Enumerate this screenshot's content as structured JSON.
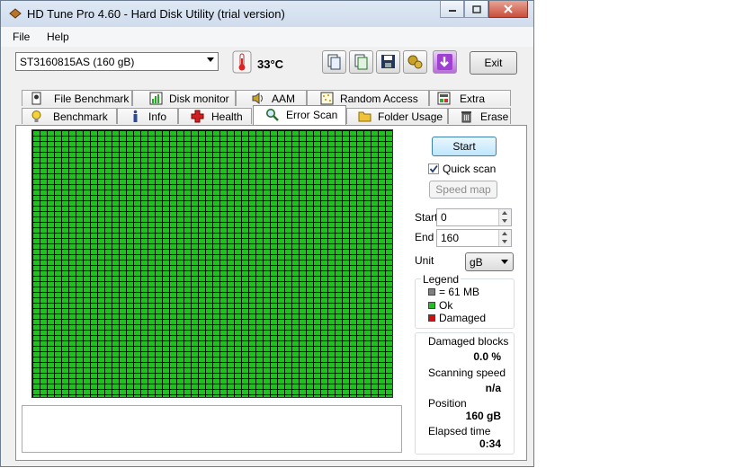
{
  "window": {
    "title": "HD Tune Pro 4.60 - Hard Disk Utility (trial version)"
  },
  "menu": {
    "file": "File",
    "help": "Help"
  },
  "toolbar": {
    "drive": "ST3160815AS (160 gB)",
    "temperature": "33°C",
    "exit_label": "Exit",
    "icons": [
      "copy-info-icon",
      "copy-report-icon",
      "save-icon",
      "options-icon",
      "download-icon"
    ]
  },
  "tabs": {
    "row_top": [
      {
        "label": "File Benchmark",
        "icon": "file-benchmark-icon"
      },
      {
        "label": "Disk monitor",
        "icon": "disk-monitor-icon"
      },
      {
        "label": "AAM",
        "icon": "speaker-icon"
      },
      {
        "label": "Random Access",
        "icon": "random-access-icon"
      },
      {
        "label": "Extra tests",
        "icon": "extra-tests-icon"
      }
    ],
    "row_bottom": [
      {
        "label": "Benchmark",
        "icon": "lightbulb-icon"
      },
      {
        "label": "Info",
        "icon": "info-icon"
      },
      {
        "label": "Health",
        "icon": "health-cross-icon"
      },
      {
        "label": "Error Scan",
        "icon": "magnifier-icon",
        "active": true
      },
      {
        "label": "Folder Usage",
        "icon": "folder-icon"
      },
      {
        "label": "Erase",
        "icon": "trash-icon"
      }
    ]
  },
  "scan": {
    "start_button": "Start",
    "quick_scan_label": "Quick scan",
    "quick_scan_checked": true,
    "speed_map_button": "Speed map",
    "start_label": "Start",
    "start_value": "0",
    "end_label": "End",
    "end_value": "160",
    "unit_label": "Unit",
    "unit_value": "gB"
  },
  "legend": {
    "title": "Legend",
    "block_size": "= 61 MB",
    "ok": "Ok",
    "damaged": "Damaged",
    "colors": {
      "block": "#808080",
      "ok": "#20c020",
      "damaged": "#d01010"
    }
  },
  "stats": {
    "damaged_blocks_label": "Damaged blocks",
    "damaged_blocks_value": "0.0 %",
    "scanning_speed_label": "Scanning speed",
    "scanning_speed_value": "n/a",
    "position_label": "Position",
    "position_value": "160 gB",
    "elapsed_time_label": "Elapsed time",
    "elapsed_time_value": "0:34"
  }
}
